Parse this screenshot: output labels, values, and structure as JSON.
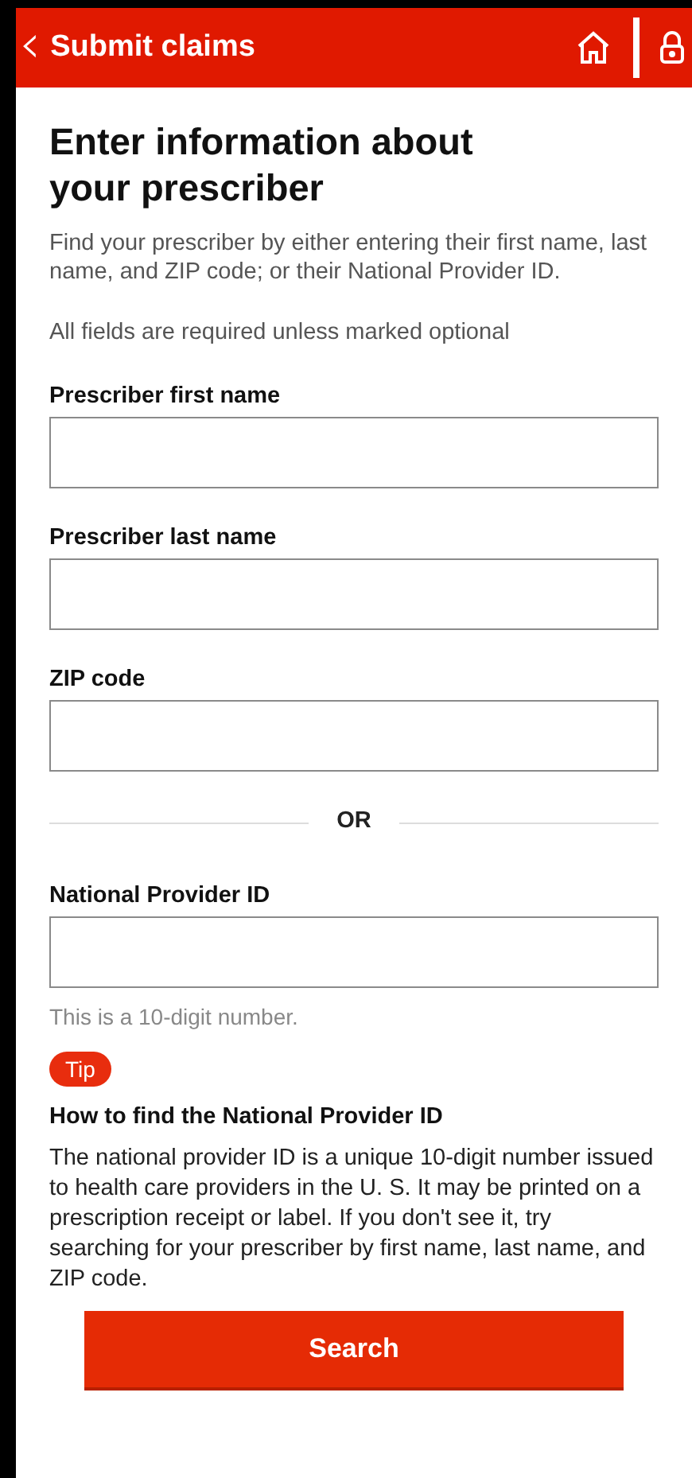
{
  "header": {
    "back_icon": "‹",
    "title": "Submit claims"
  },
  "page_title": "Enter information about your prescriber",
  "intro": "Find your prescriber by either entering their first name, last name, and ZIP code; or their National Provider ID.",
  "required_note": "All fields are required unless marked optional",
  "name_fields": [
    {
      "label": "Prescriber first name"
    },
    {
      "label": "Prescriber last name"
    },
    {
      "label": "ZIP code"
    }
  ],
  "divider_text": "OR",
  "npi_field": {
    "label": "National Provider ID",
    "hint": "This is a 10-digit number."
  },
  "tip": {
    "badge": "Tip",
    "heading": "How to find the National Provider ID",
    "body": "The national provider ID is a unique 10-digit number issued to health care providers in the U. S. It may be printed on a prescription receipt or label. If you don't see it, try searching for your prescriber by first name, last name, and ZIP code."
  },
  "search_button": "Search"
}
